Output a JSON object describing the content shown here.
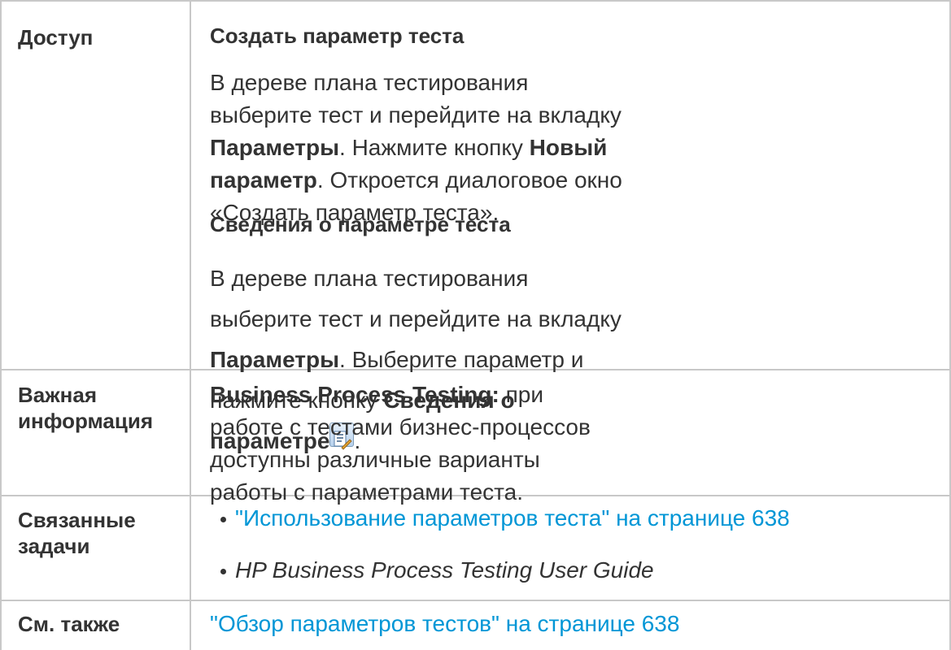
{
  "rows": {
    "access": {
      "header": "Доступ",
      "create_title": "Создать параметр теста",
      "create_text_1": "В дереве плана тестирования выберите тест и перейдите на вкладку ",
      "create_bold_1": "Параметры",
      "create_text_2": ". Нажмите кнопку ",
      "create_bold_2": "Новый параметр",
      "create_text_3": ". Откроется диалоговое окно «Создать параметр теста».",
      "details_title": "Сведения о параметре теста",
      "details_text_1": "В дереве плана тестирования выберите тест и перейдите на вкладку ",
      "details_bold_1": "Параметры",
      "details_text_2": ". Выберите параметр и нажмите кнопку ",
      "details_bold_2": "Сведения о параметре",
      "details_text_3": ".",
      "details_icon": "parameter-details-icon"
    },
    "important": {
      "header": "Важная информация",
      "bold": "Business Process Testing:",
      "text": " при работе с тестами бизнес-процессов доступны различные варианты работы с параметрами теста."
    },
    "related": {
      "header": "Связанные задачи",
      "items": [
        "\"Использование параметров теста\" на странице 638",
        "HP Business Process Testing User Guide"
      ]
    },
    "see_also": {
      "header": "См. также",
      "link": "\"Обзор параметров тестов\" на странице 638"
    }
  },
  "colors": {
    "link": "#0096d6",
    "border": "#c8c8c8",
    "text": "#333333"
  }
}
